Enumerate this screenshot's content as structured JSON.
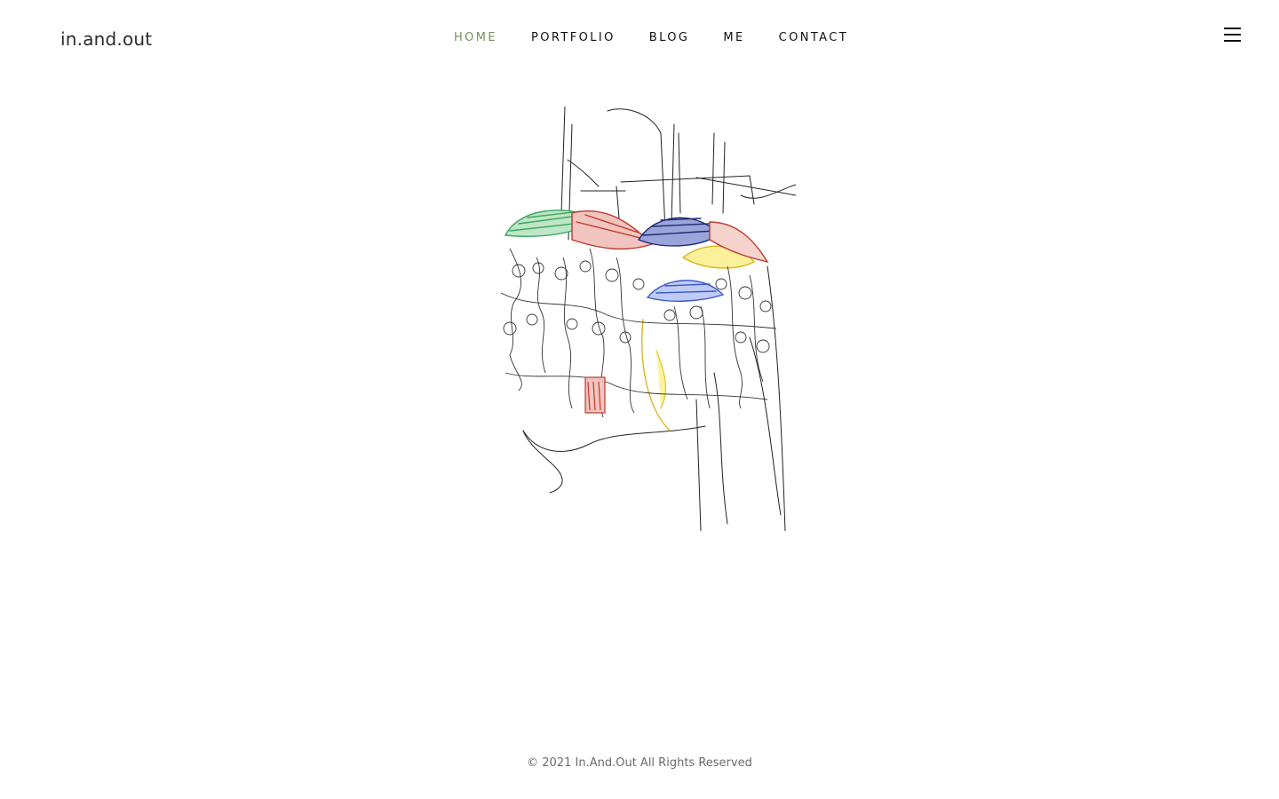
{
  "header": {
    "logo": "in.and.out",
    "nav": [
      {
        "label": "HOME",
        "active": true
      },
      {
        "label": "PORTFOLIO",
        "active": false
      },
      {
        "label": "BLOG",
        "active": false
      },
      {
        "label": "ME",
        "active": false
      },
      {
        "label": "CONTACT",
        "active": false
      }
    ],
    "menu_icon": "hamburger-icon"
  },
  "main": {
    "artwork": "sketch of a crowd under colorful umbrellas"
  },
  "footer": {
    "copyright": "© 2021 In.And.Out All Rights Reserved"
  },
  "colors": {
    "accent": "#7a8f5e",
    "text": "#111111",
    "footer_text": "#6b6b6b"
  }
}
